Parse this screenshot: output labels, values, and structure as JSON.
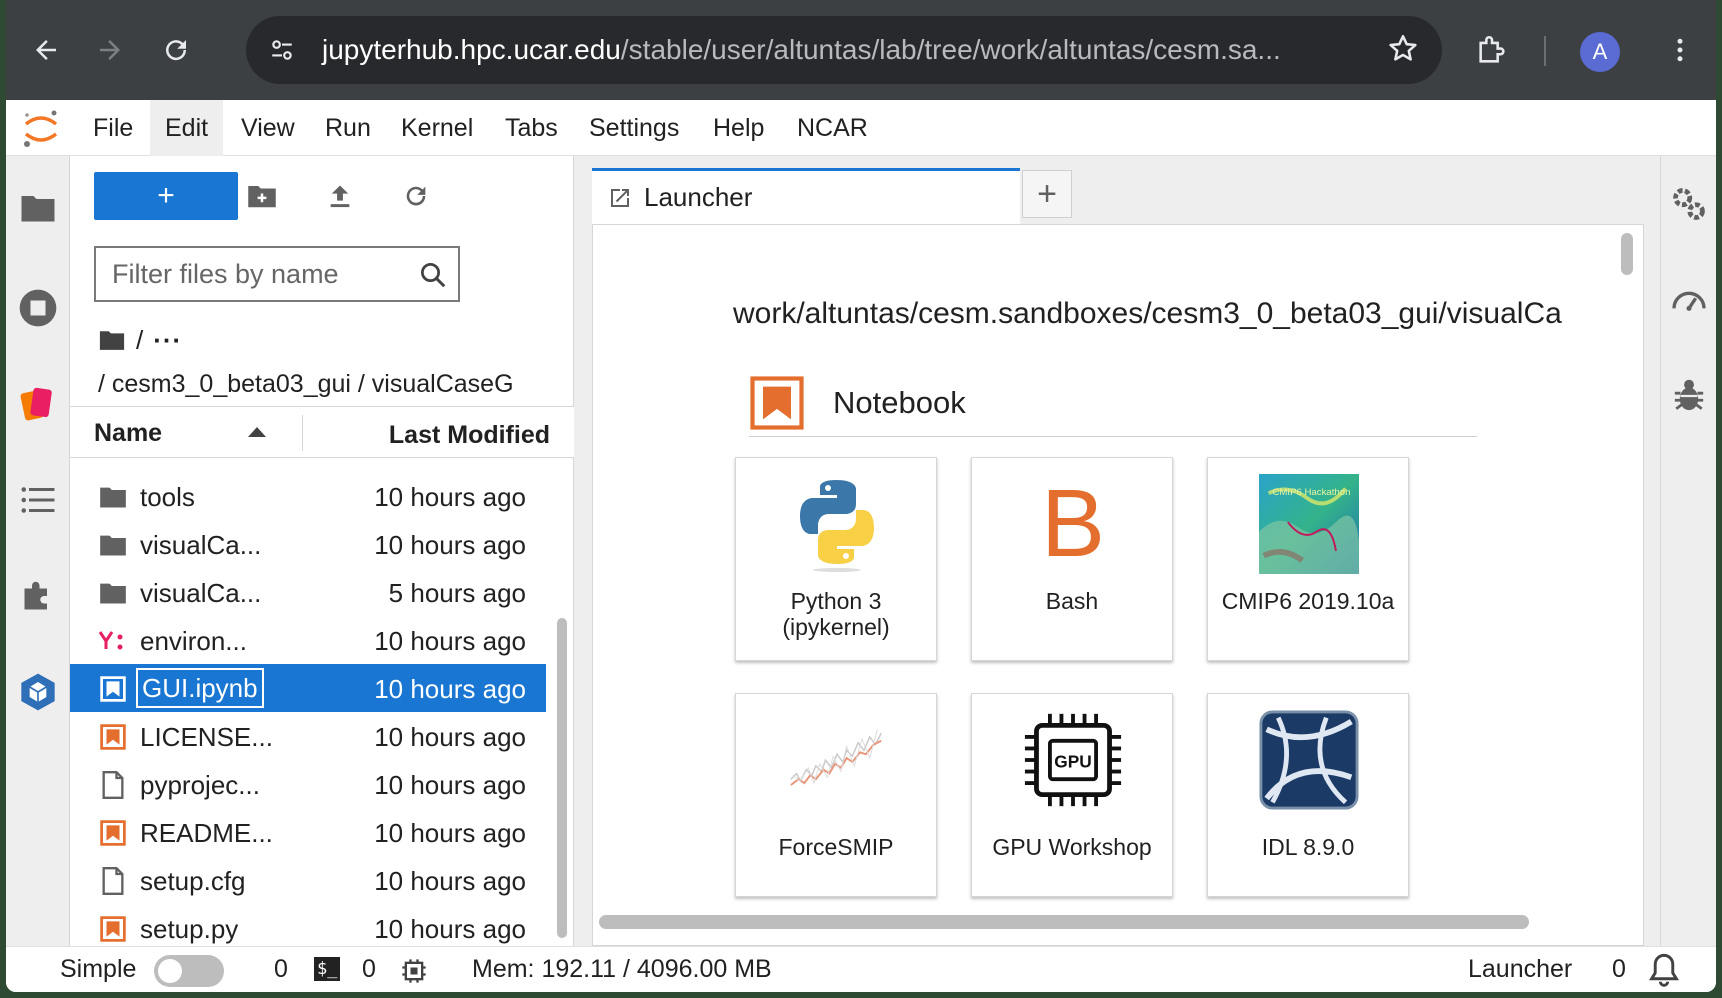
{
  "browser": {
    "url_host": "jupyterhub.hpc.ucar.edu",
    "url_path": "/stable/user/altuntas/lab/tree/work/altuntas/cesm.sa...",
    "avatar_letter": "A"
  },
  "menu": {
    "items": [
      "File",
      "Edit",
      "View",
      "Run",
      "Kernel",
      "Tabs",
      "Settings",
      "Help",
      "NCAR"
    ],
    "active": "Edit"
  },
  "filebrowser": {
    "new_label": "+",
    "filter_placeholder": "Filter files by name",
    "crumb_root": "/",
    "crumb_ellipsis": "···",
    "crumb_path": "/ cesm3_0_beta03_gui / visualCaseG",
    "col_name": "Name",
    "col_modified": "Last Modified",
    "files": [
      {
        "name": "tools",
        "modified": "10 hours ago",
        "icon": "folder-icon"
      },
      {
        "name": "visualCa...",
        "modified": "10 hours ago",
        "icon": "folder-icon"
      },
      {
        "name": "visualCa...",
        "modified": "5 hours ago",
        "icon": "folder-icon"
      },
      {
        "name": "environ...",
        "modified": "10 hours ago",
        "icon": "yaml-icon"
      },
      {
        "name": "GUI.ipynb",
        "modified": "10 hours ago",
        "icon": "notebook-icon",
        "selected": true
      },
      {
        "name": "LICENSE...",
        "modified": "10 hours ago",
        "icon": "notebook-icon"
      },
      {
        "name": "pyprojec...",
        "modified": "10 hours ago",
        "icon": "file-icon"
      },
      {
        "name": "README...",
        "modified": "10 hours ago",
        "icon": "notebook-icon"
      },
      {
        "name": "setup.cfg",
        "modified": "10 hours ago",
        "icon": "file-icon"
      },
      {
        "name": "setup.py",
        "modified": "10 hours ago",
        "icon": "notebook-icon"
      }
    ]
  },
  "launcher": {
    "tab_label": "Launcher",
    "add_tab_label": "+",
    "cwd": "work/altuntas/cesm.sandboxes/cesm3_0_beta03_gui/visualCa",
    "section_title": "Notebook",
    "kernels": [
      {
        "label": "Python 3 (ipykernel)",
        "icon": "python-icon"
      },
      {
        "label": "Bash",
        "icon": "bash-icon"
      },
      {
        "label": "CMIP6 2019.10a",
        "icon": "cmip6-map-icon"
      },
      {
        "label": "ForceSMIP",
        "icon": "forcesmip-icon"
      },
      {
        "label": "GPU Workshop",
        "icon": "gpu-icon"
      },
      {
        "label": "IDL 8.9.0",
        "icon": "idl-icon"
      }
    ],
    "bash_letter": "B",
    "cmip_overlay": "CMIP6 Hackathon"
  },
  "status": {
    "mode_label": "Simple",
    "terminals_count": "0",
    "kernels_count": "0",
    "terminal_glyph": "$_",
    "memory": "Mem: 192.11 / 4096.00 MB",
    "current": "Launcher",
    "notifications": "0"
  },
  "colors": {
    "accent": "#1976d2",
    "notebook_orange": "#e46e2e",
    "browser_dark": "#3c4043"
  }
}
